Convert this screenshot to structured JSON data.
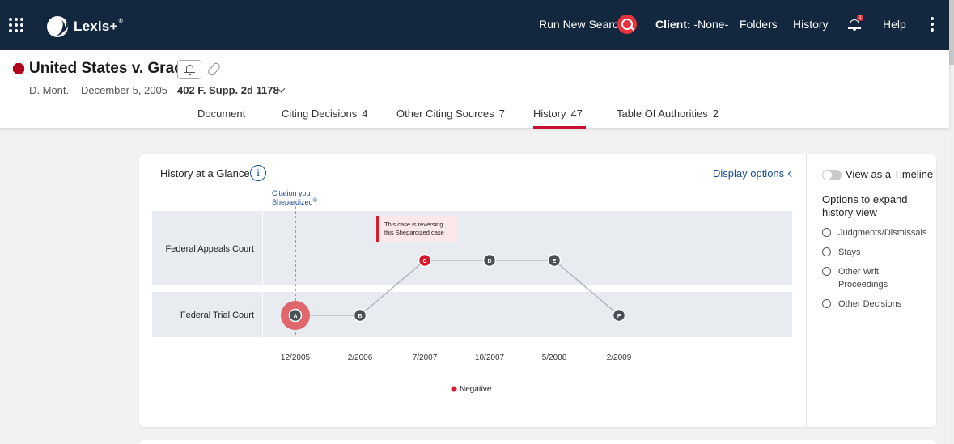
{
  "header": {
    "brand": "Lexis+",
    "brand_mark": "®",
    "run_new_search": "Run New Search",
    "client_label": "Client:",
    "client_value": "-None-",
    "folders": "Folders",
    "history": "History",
    "notification_count": "1",
    "help": "Help"
  },
  "document": {
    "title": "United States v. Grace",
    "court": "D. Mont.",
    "date": "December 5, 2005",
    "citation": "402 F. Supp. 2d 1178",
    "flag_color": "#b3001b"
  },
  "tabs": [
    {
      "label": "Document",
      "count": ""
    },
    {
      "label": "Citing Decisions",
      "count": "4"
    },
    {
      "label": "Other Citing Sources",
      "count": "7"
    },
    {
      "label": "History",
      "count": "47"
    },
    {
      "label": "Table Of Authorities",
      "count": "2"
    }
  ],
  "panel": {
    "title": "History at a Glance",
    "info": "i",
    "display_options": "Display options"
  },
  "sidebar": {
    "toggle_label": "View as a Timeline",
    "options_heading": "Options to expand history view",
    "options": [
      "Judgments/Dismissals",
      "Stays",
      "Other Writ Proceedings",
      "Other Decisions"
    ]
  },
  "chart_data": {
    "type": "line",
    "title": "",
    "courts": [
      "Federal Appeals Court",
      "Federal Trial Court"
    ],
    "x": [
      "12/2005",
      "2/2006",
      "7/2007",
      "10/2007",
      "5/2008",
      "2/2009"
    ],
    "series": [
      {
        "points": [
          {
            "label": "A",
            "x": "12/2005",
            "court": "Federal Trial Court",
            "negative": false,
            "shepardized": true
          },
          {
            "label": "B",
            "x": "2/2006",
            "court": "Federal Trial Court",
            "negative": false
          },
          {
            "label": "C",
            "x": "7/2007",
            "court": "Federal Appeals Court",
            "negative": true
          },
          {
            "label": "D",
            "x": "10/2007",
            "court": "Federal Appeals Court",
            "negative": false
          },
          {
            "label": "E",
            "x": "5/2008",
            "court": "Federal Appeals Court",
            "negative": false
          },
          {
            "label": "F",
            "x": "2/2009",
            "court": "Federal Trial Court",
            "negative": false
          }
        ]
      }
    ],
    "marker_label": "Citation you Shepardized",
    "marker_label_line1": "Citation you",
    "marker_label_line2": "Shepardized",
    "marker_reg": "®",
    "annotation_line1": "This case is reversing",
    "annotation_line2": "this Shepardized case",
    "legend": [
      {
        "name": "Negative",
        "color": "#d7192d"
      }
    ],
    "colors": {
      "node": "#4a4f55",
      "negative": "#d7192d",
      "highlight": "#e0666e",
      "band": "#e8ebef",
      "marker": "#1a4d9c"
    }
  }
}
